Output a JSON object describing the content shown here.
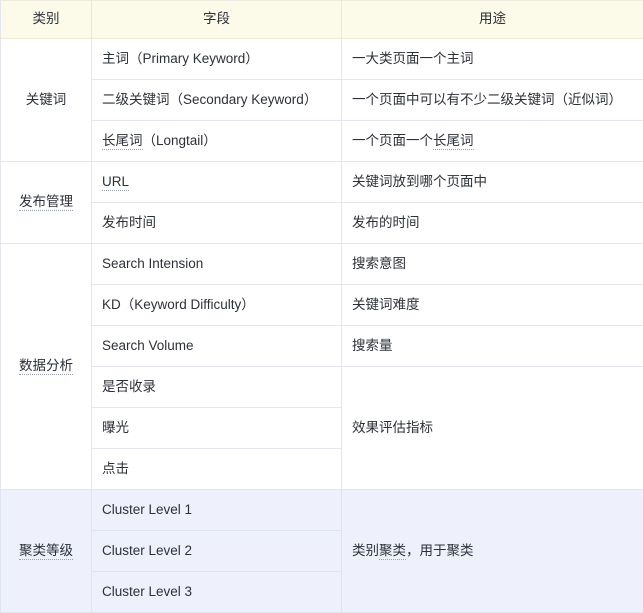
{
  "table": {
    "headers": [
      "类别",
      "字段",
      "用途"
    ],
    "groups": [
      {
        "category": "关键词",
        "category_dotted": false,
        "highlight": false,
        "rows": [
          {
            "field": "主词（Primary Keyword）",
            "purpose": "一大类页面一个主词"
          },
          {
            "field": "二级关键词（Secondary Keyword）",
            "purpose": "一个页面中可以有不少二级关键词（近似词）"
          },
          {
            "field": "长尾词（Longtail）",
            "field_dotted": "长尾词",
            "purpose": "一个页面一个长尾词",
            "purpose_dotted": "长尾词"
          }
        ]
      },
      {
        "category": "发布管理",
        "category_dotted": true,
        "highlight": false,
        "rows": [
          {
            "field": "URL",
            "field_dotted": "URL",
            "purpose": "关键词放到哪个页面中"
          },
          {
            "field": "发布时间",
            "purpose": "发布的时间"
          }
        ]
      },
      {
        "category": "数据分析",
        "category_dotted": true,
        "highlight": false,
        "rows": [
          {
            "field": "Search Intension",
            "purpose": "搜索意图"
          },
          {
            "field": "KD（Keyword Difficulty）",
            "purpose": "关键词难度"
          },
          {
            "field": "Search Volume",
            "purpose": "搜索量"
          },
          {
            "field": "是否收录",
            "purpose": "效果评估指标",
            "purpose_rowspan": 3
          },
          {
            "field": "曝光"
          },
          {
            "field": "点击"
          }
        ]
      },
      {
        "category": "聚类等级",
        "category_dotted": true,
        "highlight": true,
        "rows": [
          {
            "field": "Cluster Level 1",
            "purpose": "类别聚类，用于聚类",
            "purpose_dotted": "聚类",
            "purpose_rowspan": 3
          },
          {
            "field": "Cluster Level 2"
          },
          {
            "field": "Cluster Level 3"
          }
        ]
      }
    ]
  },
  "colors": {
    "header_bg": "#fcfbe9",
    "highlight_bg": "#eef1fb",
    "border": "#e3e6ec",
    "text": "#2c3038"
  }
}
